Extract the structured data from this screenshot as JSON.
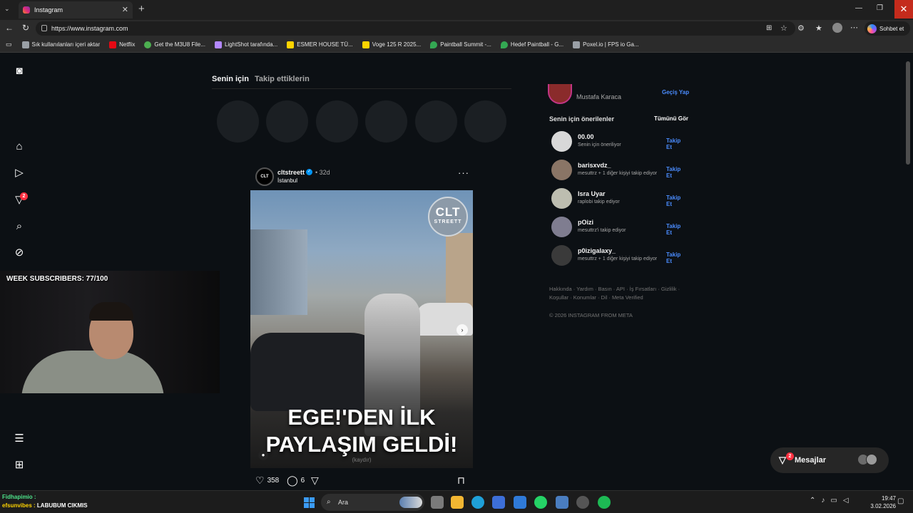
{
  "browser": {
    "tab_title": "Instagram",
    "url": "https://www.instagram.com",
    "copilot_label": "Sohbet et",
    "bookmarks": [
      {
        "label": "Sık kullanılanları içeri aktar",
        "color": "#9aa0a6"
      },
      {
        "label": "Netflix",
        "color": "#e50914"
      },
      {
        "label": "Get the M3U8 File...",
        "color": "#4caf50"
      },
      {
        "label": "LightShot tarafında...",
        "color": "#b388ff"
      },
      {
        "label": "ESMER HOUSE TÜ...",
        "color": "#ffd400"
      },
      {
        "label": "Voge 125 R 2025...",
        "color": "#ffd400"
      },
      {
        "label": "Paintball Summit -...",
        "color": "#34a853"
      },
      {
        "label": "Hedef Paintball - G...",
        "color": "#34a853"
      },
      {
        "label": "Poxel.io | FPS io Ga...",
        "color": "#9aa0a6"
      }
    ]
  },
  "nav": {
    "messages_badge": "2"
  },
  "feed": {
    "tab_for_you": "Senin için",
    "tab_following": "Takip ettiklerin"
  },
  "post": {
    "username": "cltstreett",
    "time": "32d",
    "location": "İstanbul",
    "avatar_text": "CLT",
    "logo_line1": "CLT",
    "logo_line2": "STREETT",
    "caption_line1": "EGE!'DEN İLK",
    "caption_line2": "PAYLAŞIM GELDİ!",
    "caption_sub": "(kaydır)",
    "likes": "358",
    "comments": "6"
  },
  "sidebar": {
    "current_user_name": "Mustafa Karaca",
    "switch_label": "Geçiş Yap",
    "suggested_title": "Senin için önerilenler",
    "see_all": "Tümünü Gör",
    "suggestions": [
      {
        "name": "00.00",
        "sub": "Senin için öneriliyor",
        "follow": "Takip Et"
      },
      {
        "name": "barisxvdz_",
        "sub": "mesuttrz + 1 diğer kişiyi takip ediyor",
        "follow": "Takip Et"
      },
      {
        "name": "Isra Uyar",
        "sub": "raplobi takip ediyor",
        "follow": "Takip Et"
      },
      {
        "name": "pOizi",
        "sub": "mesuttrz'i takip ediyor",
        "follow": "Takip Et"
      },
      {
        "name": "p0izigalaxy_",
        "sub": "mesuttrz + 1 diğer kişiyi takip ediyor",
        "follow": "Takip Et"
      }
    ],
    "footer_line1": "Hakkında · Yardım · Basın · API · İş Fırsatları · Gizlilik ·",
    "footer_line2": "Koşullar · Konumlar · Dil · Meta Verified",
    "copyright": "© 2026 INSTAGRAM FROM META"
  },
  "messages": {
    "label": "Mesajlar",
    "badge": "2"
  },
  "stream": {
    "subs_text": "WEEK SUBSCRIBERS: 77/100",
    "line1_name": "Fidhapimio :",
    "line2_name": "efsunvibes :",
    "line2_text": "LABUBUM CIKMIS"
  },
  "taskbar": {
    "search_label": "Ara",
    "time": "19:47",
    "date": "3.02.2026"
  }
}
